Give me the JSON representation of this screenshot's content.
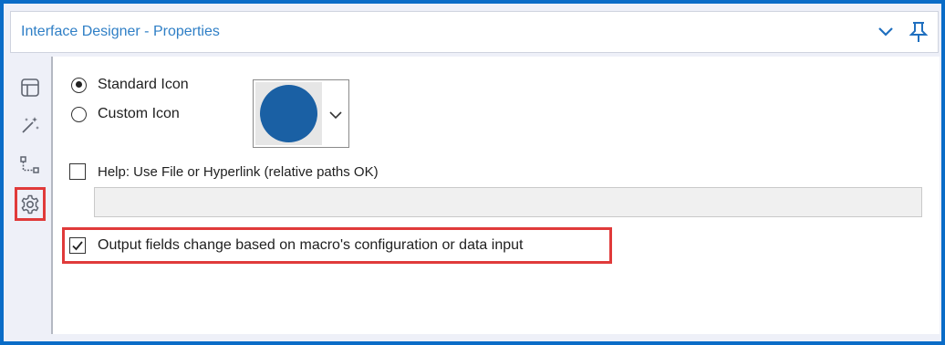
{
  "panel": {
    "title": "Interface Designer - Properties",
    "collapse_icon": "chevron-down-icon",
    "pin_icon": "pin-icon",
    "accent_color": "#0a6cc7",
    "highlight_color": "#e03a3a"
  },
  "sidebar": {
    "items": [
      {
        "icon": "layout-icon",
        "active": false
      },
      {
        "icon": "magic-wand-icon",
        "active": false
      },
      {
        "icon": "tree-icon",
        "active": false
      },
      {
        "icon": "gear-icon",
        "active": true
      }
    ]
  },
  "icon_options": {
    "standard_label": "Standard Icon",
    "custom_label": "Custom Icon",
    "selected": "Standard Icon",
    "icon_color": "#1a60a4"
  },
  "help": {
    "label": "Help: Use File or Hyperlink (relative paths OK)",
    "checked": false,
    "value": ""
  },
  "output_fields": {
    "label": "Output fields change based on macro's configuration or data input",
    "checked": true
  }
}
